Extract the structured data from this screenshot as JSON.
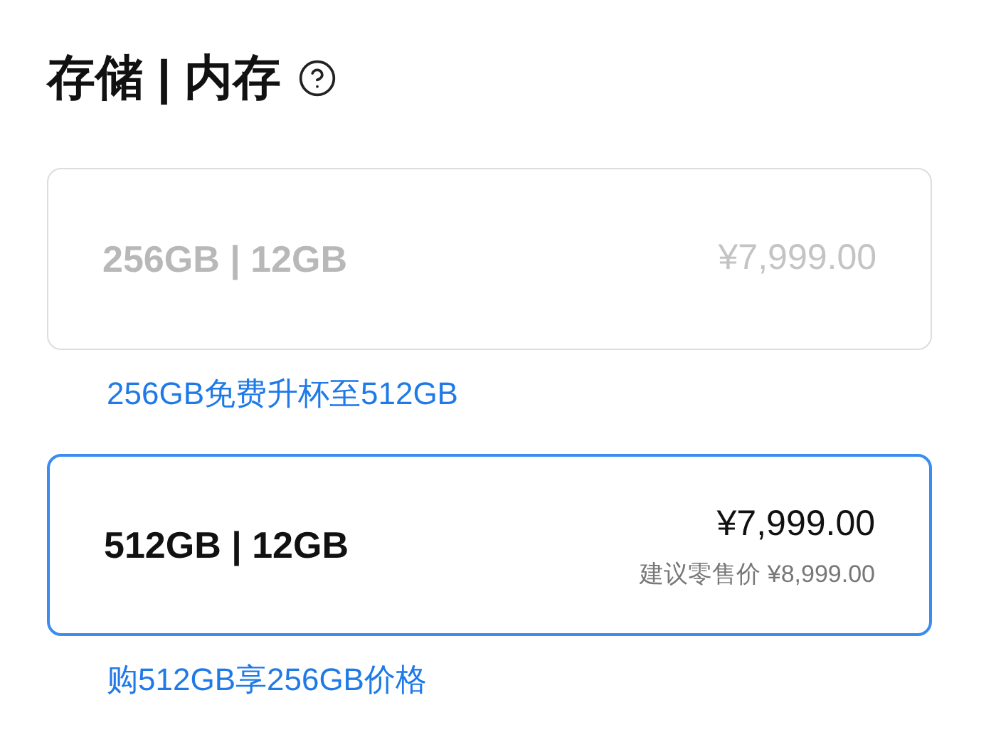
{
  "title": "存储 | 内存",
  "options": [
    {
      "spec": "256GB | 12GB",
      "price": "¥7,999.00",
      "disabled": true,
      "selected": false,
      "promo": "256GB免费升杯至512GB"
    },
    {
      "spec": "512GB | 12GB",
      "price": "¥7,999.00",
      "suggested": "建议零售价 ¥8,999.00",
      "disabled": false,
      "selected": true,
      "promo": "购512GB享256GB价格"
    }
  ]
}
